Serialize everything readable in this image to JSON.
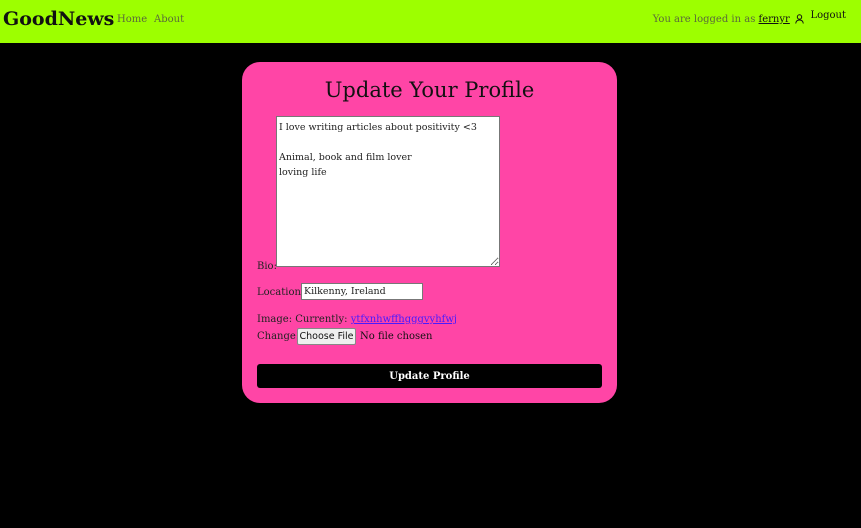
{
  "navbar": {
    "brand": "GoodNews",
    "links": {
      "home": "Home",
      "about": "About"
    },
    "login_prefix": "You are logged in as",
    "username": "fernyr",
    "user_icon": "person-icon",
    "logout": "Logout"
  },
  "form": {
    "title": "Update Your Profile",
    "bio_label": "Bio:",
    "bio_value": "I love writing articles about positivity <3\n\nAnimal, book and film lover\nloving life",
    "location_label": "Location:",
    "location_value": "Kilkenny, Ireland",
    "image_label": "Image: Currently:",
    "image_current": "ytfxnhwffhgggvyhfwj",
    "change_label": "Change:",
    "file_button": "Choose File",
    "file_status": "No file chosen",
    "submit": "Update Profile"
  },
  "colors": {
    "navbar_bg": "#9dff00",
    "card_bg": "#ff45a6",
    "page_bg": "#000000",
    "button_bg": "#000000"
  }
}
